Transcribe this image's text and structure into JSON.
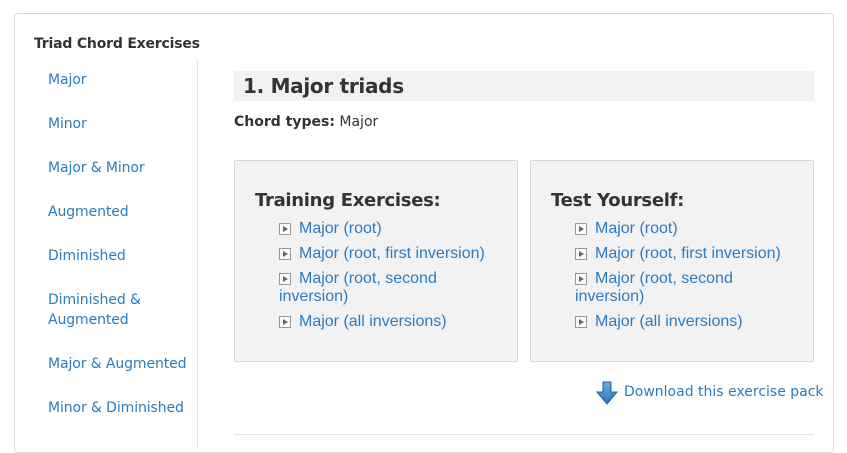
{
  "sidebar": {
    "title": "Triad Chord Exercises",
    "items": [
      {
        "label": "Major"
      },
      {
        "label": "Minor"
      },
      {
        "label": "Major & Minor"
      },
      {
        "label": "Augmented"
      },
      {
        "label": "Diminished"
      },
      {
        "label": "Diminished & Augmented"
      },
      {
        "label": "Major & Augmented"
      },
      {
        "label": "Minor & Diminished"
      }
    ]
  },
  "main": {
    "title": "1. Major triads",
    "chord_types_label": "Chord types:",
    "chord_types_value": "Major"
  },
  "training": {
    "heading": "Training Exercises:",
    "links": [
      {
        "label": "Major (root)"
      },
      {
        "label": "Major (root, first inversion)"
      },
      {
        "label": "Major (root, second inversion)"
      },
      {
        "label": "Major (all inversions)"
      }
    ]
  },
  "test": {
    "heading": "Test Yourself:",
    "links": [
      {
        "label": "Major (root)"
      },
      {
        "label": "Major (root, first inversion)"
      },
      {
        "label": "Major (root, second inversion)"
      },
      {
        "label": "Major (all inversions)"
      }
    ]
  },
  "download": {
    "label": "Download this exercise pack",
    "icon": "download-arrow-icon"
  },
  "colors": {
    "link": "#2a7cc1",
    "panel_bg": "#f2f2f2",
    "text": "#333333",
    "icon_arrow": "#2e73b8"
  }
}
